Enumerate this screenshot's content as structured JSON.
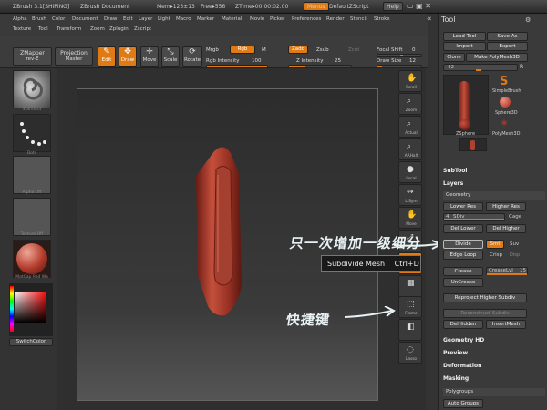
{
  "titlebar": {
    "app": "ZBrush 3.1[SHIPING]",
    "doc": "ZBrush Document",
    "mem": "Mem▸123±13",
    "free": "Free▸556",
    "ztime": "ZTime▸00:00:02.00",
    "menus_btn": "Menus",
    "script": "DefaultZScript",
    "help": "Help"
  },
  "menus": [
    "Alpha",
    "Brush",
    "Color",
    "Document",
    "Draw",
    "Edit",
    "Layer",
    "Light",
    "Macro",
    "Marker",
    "Material",
    "Movie",
    "Picker",
    "Preferences",
    "Render",
    "Stencil",
    "Stroke",
    "Texture",
    "Tool",
    "Transform",
    "Zoom",
    "Zplugin",
    "Zscript"
  ],
  "shelf": {
    "zmapper": "ZMapper",
    "zmapper_rev": "rev-E",
    "projection": "Projection",
    "projection_sub": "Master",
    "edit": "Edit",
    "draw": "Draw",
    "move": "Move",
    "scale": "Scale",
    "rotate": "Rotate",
    "mrgb": "Mrgb",
    "rgb": "Rgb",
    "m": "M",
    "rgb_intensity": "Rgb Intensity",
    "rgb_intensity_val": "100",
    "zadd": "Zadd",
    "zsub": "Zsub",
    "zcut": "Zcut",
    "z_intensity": "Z Intensity",
    "z_intensity_val": "25",
    "focal_shift": "Focal Shift",
    "focal_shift_val": "0",
    "draw_size": "Draw Size",
    "draw_size_val": "12"
  },
  "left": {
    "standard": "Standard",
    "dots": "Dots",
    "alpha": "Alpha  Off",
    "texture": "Texture  Off",
    "matcap": "MatCap Red Wa",
    "switchcolor": "SwitchColor"
  },
  "righttools": {
    "scroll": "Scroll",
    "zoom": "Zoom",
    "actual": "Actual",
    "aahalf": "AAHalf",
    "local": "Local",
    "lsym": "L.Sym",
    "move": "Move",
    "frame": "Frame",
    "lasso": "Lasso"
  },
  "tooltip": {
    "text": "Subdivide Mesh",
    "shortcut": "Ctrl+D"
  },
  "annotations": {
    "a1": "只一次增加一级细分",
    "a2": "快捷键"
  },
  "toolpanel": {
    "title": "Tool",
    "load": "Load Tool",
    "saveas": "Save As",
    "import": "Import",
    "export": "Export",
    "clone": "Clone",
    "makepoly": "Make PolyMesh3D",
    "value": "42",
    "r": "R",
    "simplebrush": "SimpleBrush",
    "sphere3d": "Sphere3D",
    "zsphere": "ZSphere",
    "polymesh": "PolyMesh3D",
    "subtool": "SubTool",
    "layers": "Layers",
    "geometry": "Geometry",
    "lower_res": "Lower Res",
    "higher_res": "Higher Res",
    "sdiv": "SDiv",
    "sdiv_val": "4",
    "cage": "Cage",
    "del_lower": "Del Lower",
    "del_higher": "Del Higher",
    "divide": "Divide",
    "smt": "Smt",
    "suv": "Suv",
    "edge_loop": "Edge Loop",
    "crisp": "Crisp",
    "disp": "Disp",
    "crease": "Crease",
    "creaselvl": "CreaseLvl",
    "creaselvl_val": "15",
    "uncrease": "UnCrease",
    "reproject": "Reproject Higher Subdiv",
    "reconstruct": "Reconstruct Subdiv",
    "delhidden": "DelHidden",
    "insertmesh": "InsertMesh",
    "geometry_hd": "Geometry HD",
    "preview": "Preview",
    "deformation": "Deformation",
    "masking": "Masking",
    "polygroups": "Polygroups",
    "auto_groups": "Auto Groups"
  },
  "colors": {
    "accent": "#e07a14",
    "model": "#a8382a"
  }
}
